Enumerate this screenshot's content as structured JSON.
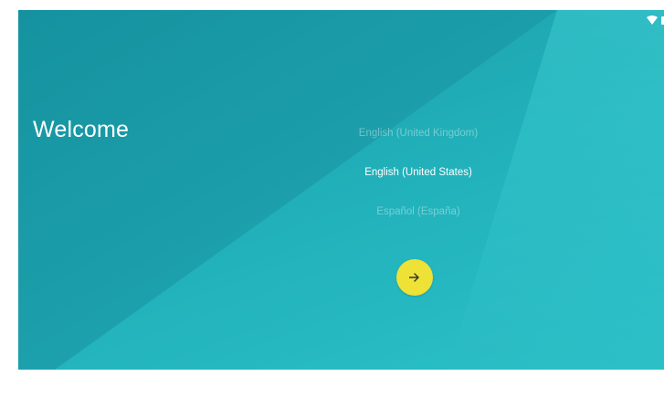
{
  "welcome": {
    "title": "Welcome"
  },
  "languages": [
    {
      "label": "English (United Kingdom)",
      "state": "faded"
    },
    {
      "label": "English (United States)",
      "state": "selected"
    },
    {
      "label": "Español (España)",
      "state": "faded"
    }
  ],
  "next_button": {
    "icon": "arrow-right-icon"
  },
  "status_bar": {
    "icons": [
      "wifi-icon",
      "battery-icon"
    ]
  },
  "colors": {
    "background_teal": "#22b2bb",
    "accent_yellow": "#eee237",
    "text": "#ffffff"
  }
}
